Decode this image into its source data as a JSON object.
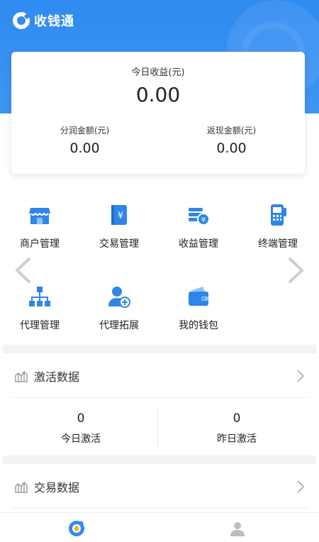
{
  "brand": {
    "name": "收钱通",
    "logo_icon": "logo-icon"
  },
  "earnings": {
    "today_label": "今日收益(元)",
    "today_value": "0.00",
    "split_label": "分润金额(元)",
    "split_value": "0.00",
    "cashback_label": "返现金额(元)",
    "cashback_value": "0.00"
  },
  "menu": {
    "items": [
      {
        "label": "商户管理",
        "icon": "store-icon"
      },
      {
        "label": "交易管理",
        "icon": "ledger-icon"
      },
      {
        "label": "收益管理",
        "icon": "coins-icon"
      },
      {
        "label": "终端管理",
        "icon": "pos-terminal-icon"
      },
      {
        "label": "代理管理",
        "icon": "org-chart-icon"
      },
      {
        "label": "代理拓展",
        "icon": "add-user-icon"
      },
      {
        "label": "我的钱包",
        "icon": "wallet-icon"
      }
    ]
  },
  "activation": {
    "title": "激活数据",
    "today_value": "0",
    "today_label": "今日激活",
    "yesterday_value": "0",
    "yesterday_label": "昨日激活"
  },
  "transactions": {
    "title": "交易数据"
  },
  "colors": {
    "primary": "#2f8bf0",
    "icon_blue": "#2e86e8",
    "muted": "#bdbdbd"
  }
}
